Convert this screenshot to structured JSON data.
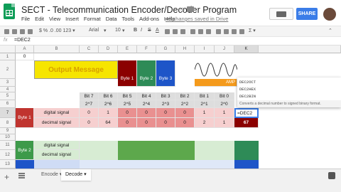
{
  "app": {
    "title": "SECT - Telecommunication Encoder/Decoder Program",
    "save_status": "All changes saved in Drive",
    "share_label": "SHARE"
  },
  "menu": [
    "File",
    "Edit",
    "View",
    "Insert",
    "Format",
    "Data",
    "Tools",
    "Add-ons",
    "Help"
  ],
  "toolbar": {
    "font": "Arial",
    "font_size": "10",
    "bold": "B",
    "italic": "I",
    "strike": "S",
    "text_color": "A"
  },
  "formula_bar": {
    "fx": "fx",
    "value": "=DEC2"
  },
  "columns": [
    "A",
    "B",
    "C",
    "D",
    "E",
    "F",
    "G",
    "H",
    "I",
    "J",
    "K"
  ],
  "rows": [
    "1",
    "2",
    "3",
    "4",
    "5",
    "6",
    "7",
    "8",
    "9",
    "10",
    "11",
    "12",
    "13"
  ],
  "sheet": {
    "a1": "0",
    "output_message": "Output Message",
    "byte_labels": [
      "Byte 1",
      "Byte 2",
      "Byte 3"
    ],
    "partial_header": "AMP",
    "bits": [
      "Bit 7",
      "Bit 6",
      "Bit 5",
      "Bit 4",
      "Bit 3",
      "Bit 2",
      "Bit 1",
      "Bit 0"
    ],
    "powers": [
      "2^7",
      "2^6",
      "2^5",
      "2^4",
      "2^3",
      "2^2",
      "2^1",
      "2^0"
    ],
    "byte1": {
      "label": "Byte 1",
      "row_labels": [
        "digital signal",
        "decimal signal"
      ],
      "digital": [
        "0",
        "1",
        "0",
        "0",
        "0",
        "0",
        "1",
        "1"
      ],
      "decimal": [
        "0",
        "64",
        "0",
        "0",
        "0",
        "0",
        "2",
        "1"
      ],
      "k_input": "=DEC2",
      "k_result": "67"
    },
    "byte2": {
      "label": "Byte 2",
      "row_labels": [
        "digital signal",
        "decimal signal"
      ]
    }
  },
  "autocomplete": {
    "options": [
      "DEC2OCT",
      "DEC2HEX",
      "DEC2BIN"
    ],
    "description": "Converts a decimal number to signed binary format."
  },
  "tabs": [
    "Encode",
    "Decode"
  ],
  "active_tab": "Decode",
  "colors": {
    "title_bg": "#f6e500",
    "title_text": "#d8a000",
    "byte1": "#8b0000",
    "byte2": "#2e8b57",
    "byte3": "#1e55c8",
    "amp": "#f49a1c",
    "byte1_row": "#c0342f",
    "byte1_light": "#f6cfcf",
    "byte1_mid": "#e99090",
    "byte2_row": "#3d9a4a",
    "byte2_light": "#d7ecd3",
    "byte2_mid": "#5da84c",
    "accent": "#3b7de8"
  }
}
